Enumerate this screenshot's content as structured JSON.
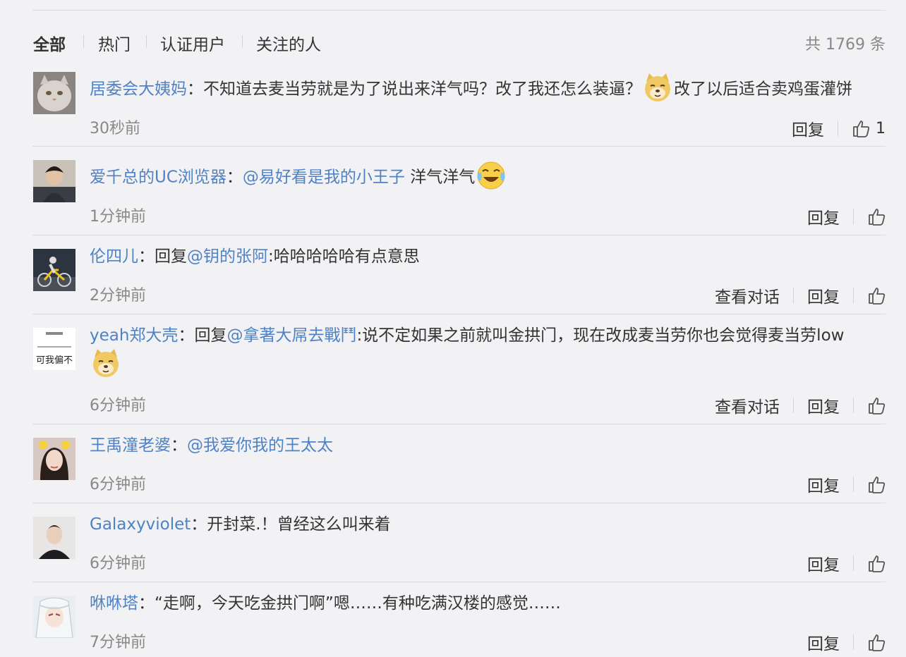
{
  "filters": [
    {
      "label": "全部",
      "active": true
    },
    {
      "label": "热门",
      "active": false
    },
    {
      "label": "认证用户",
      "active": false
    },
    {
      "label": "关注的人",
      "active": false
    }
  ],
  "total_label": "共 1769 条",
  "action_labels": {
    "reply": "回复",
    "view_conversation": "查看对话"
  },
  "comments": [
    {
      "username": "居委会大姨妈",
      "sep": "：",
      "text1": "不知道去麦当劳就是为了说出来洋气吗？改了我还怎么装逼？",
      "emoji": "doge-emoji",
      "text2": "改了以后适合卖鸡蛋灌饼",
      "time": "30秒前",
      "like_count": "1"
    },
    {
      "username": "爱千总的UC浏览器",
      "sep": "：",
      "mention": "@易好看是我的小王子",
      "text": " 洋气洋气",
      "emoji": "laughing-tears-emoji",
      "time": "1分钟前"
    },
    {
      "username": "伦四儿",
      "sep": "：",
      "prefix": "回复",
      "mention": "@钥的张阿",
      "text": ":哈哈哈哈哈有点意思",
      "time": "2分钟前"
    },
    {
      "username": "yeah郑大壳",
      "sep": "：",
      "prefix": "回复",
      "mention": "@拿著大屌去戰鬥",
      "text": ":说不定如果之前就叫金拱门，现在改成麦当劳你也会觉得麦当劳low",
      "emoji": "doge-emoji",
      "time": "6分钟前",
      "avatar_text": "可我偏不"
    },
    {
      "username": "王禹潼老婆",
      "sep": "：",
      "mention": "@我爱你我的王太太",
      "time": "6分钟前"
    },
    {
      "username": "Galaxyviolet",
      "sep": "：",
      "text": "开封菜.！曾经这么叫来着",
      "time": "6分钟前"
    },
    {
      "username": "咻咻塔",
      "sep": "：",
      "text": "“走啊，今天吃金拱门啊”嗯……有种吃满汉楼的感觉……",
      "time": "7分钟前"
    }
  ]
}
